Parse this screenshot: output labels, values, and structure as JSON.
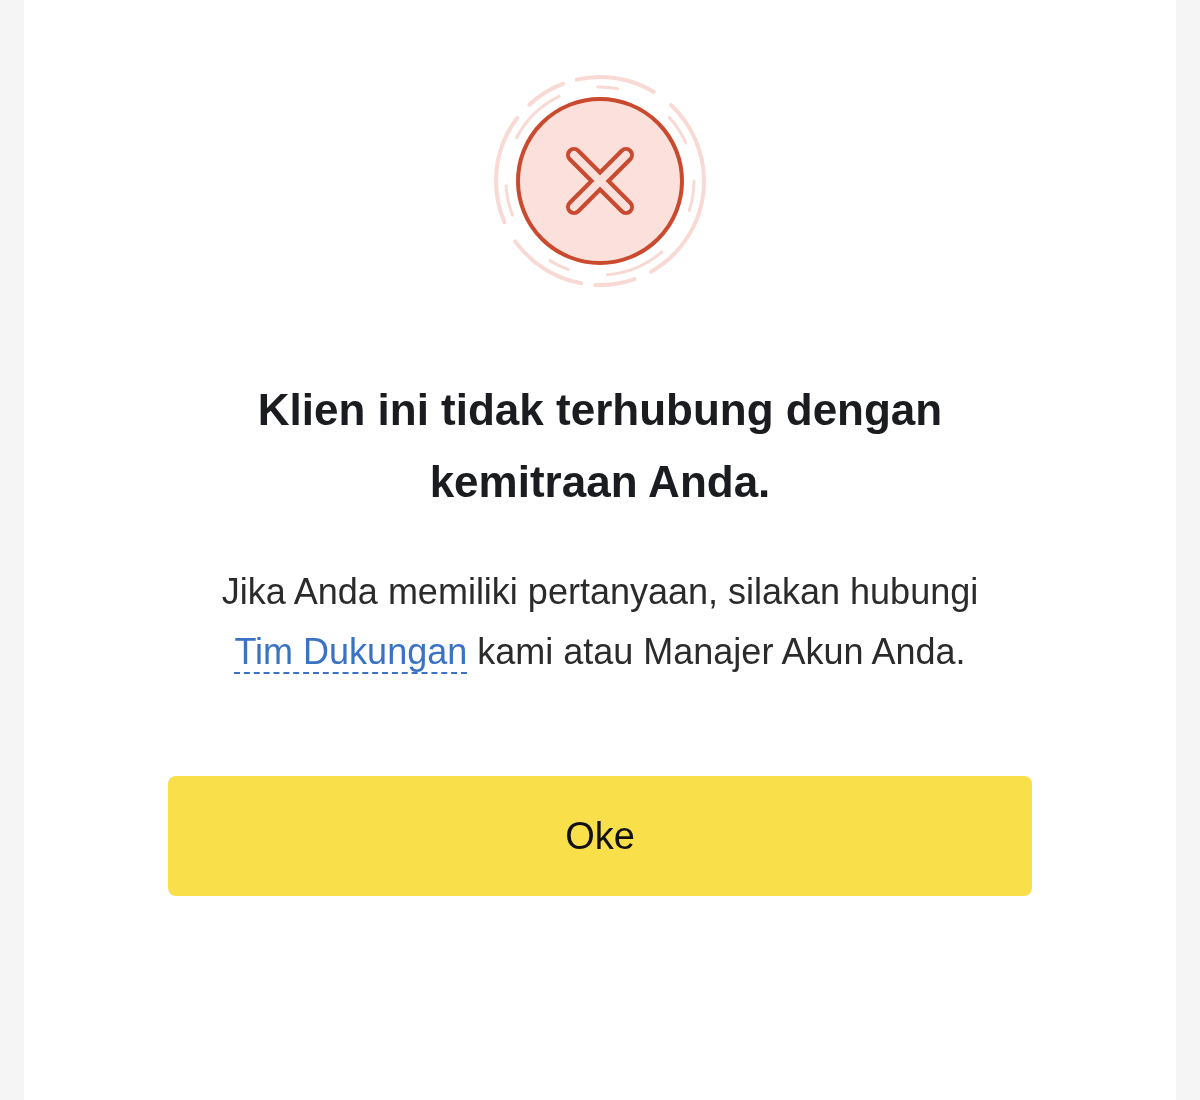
{
  "dialog": {
    "title": "Klien ini tidak terhubung dengan kemitraan Anda.",
    "message": {
      "before": "Jika Anda memiliki pertanyaan, silakan hubungi ",
      "link": "Tim Dukungan",
      "after": " kami atau Manajer Akun Anda."
    },
    "button": "Oke"
  }
}
